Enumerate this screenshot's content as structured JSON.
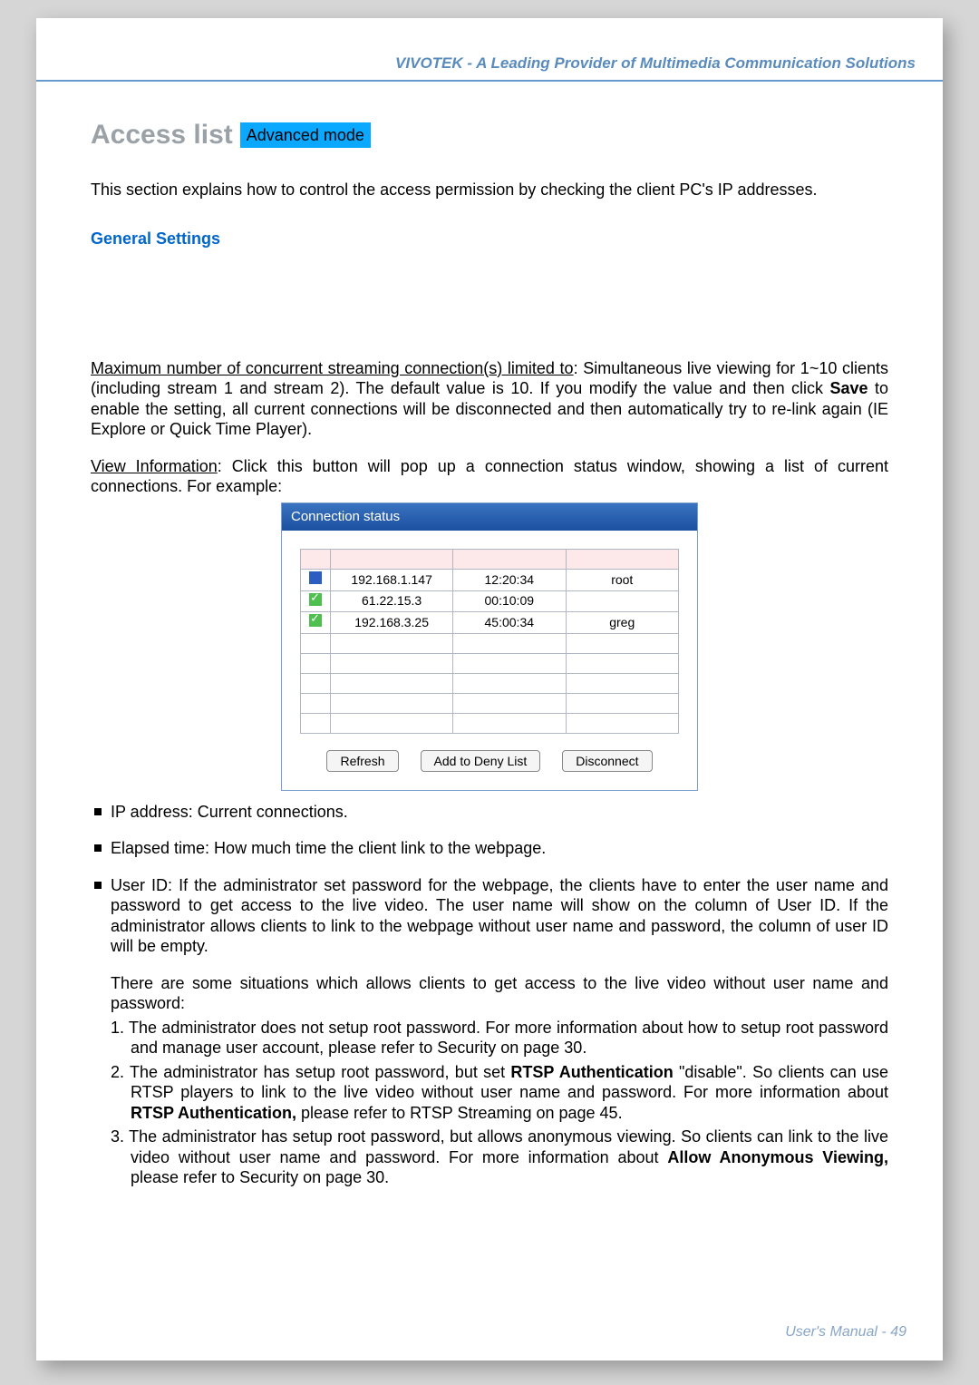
{
  "header": {
    "tagline": "VIVOTEK - A Leading Provider of Multimedia Communication Solutions"
  },
  "title": {
    "heading": "Access list",
    "badge": "Advanced mode"
  },
  "intro": "This section explains how to control the access permission by checking the client PC's IP addresses.",
  "section_sub": "General Settings",
  "max_conn": {
    "u": "Maximum number of concurrent streaming connection(s) limited to",
    "rest1": ": Simultaneous live viewing for 1~10 clients (including stream 1 and stream 2). The default value is 10. If you modify the value and then click ",
    "save": "Save",
    "rest2": " to enable the setting, all current connections will be disconnected and then automatically try to re-link again (IE Explore or Quick Time Player)."
  },
  "view_info": {
    "u": "View Information",
    "rest": ": Click this button will pop up a connection status window, showing a list of current connections. For example:"
  },
  "popup": {
    "title": "Connection status",
    "headers": [
      "",
      "",
      "",
      ""
    ],
    "rows": [
      {
        "icon": "blue",
        "ip": "192.168.1.147",
        "elapsed": "12:20:34",
        "user": "root"
      },
      {
        "icon": "green",
        "ip": "61.22.15.3",
        "elapsed": "00:10:09",
        "user": ""
      },
      {
        "icon": "green",
        "ip": "192.168.3.25",
        "elapsed": "45:00:34",
        "user": "greg"
      }
    ],
    "buttons": {
      "refresh": "Refresh",
      "add_deny": "Add to Deny List",
      "disconnect": "Disconnect"
    }
  },
  "bullets": {
    "ip": "IP address: Current connections.",
    "elapsed": "Elapsed time: How much time the client link to the webpage.",
    "user": "User ID: If the administrator set password for the webpage, the clients have to enter the user name and password to get access to the live video. The user name will show on the column of User ID. If the administrator allows clients to link to the webpage without user name and password, the column of user ID will be empty."
  },
  "situations": {
    "intro": "There are some situations which allows clients to get access to the live video without user name and password:",
    "items": [
      {
        "pre": "1. The administrator does not setup root password. For more information about how to setup root password and manage user account, please refer to Security on page 30."
      },
      {
        "pre": "2. The administrator has setup root password, but set ",
        "b1": "RTSP Authentication",
        "mid": " \"disable\". So clients can use RTSP players to link to the live video without user name and password. For more information about ",
        "b2": "RTSP Authentication,",
        "post": " please refer to RTSP Streaming on page 45."
      },
      {
        "pre": "3. The administrator has setup root password, but allows anonymous viewing. So clients can link to the live video without user name and password. For more information about ",
        "b1": "Allow Anonymous Viewing,",
        "post": " please refer to Security on page 30."
      }
    ]
  },
  "footer": "User's Manual - 49"
}
